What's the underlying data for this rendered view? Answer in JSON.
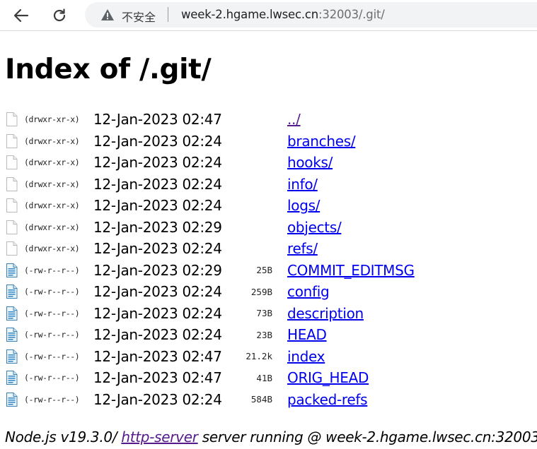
{
  "browser": {
    "security_label": "不安全",
    "url_host": "week-2.hgame.lwsec.cn",
    "url_rest": ":32003/.git/"
  },
  "page": {
    "title": "Index of /.git/",
    "entries": [
      {
        "icon": "folder-icon",
        "perms": "(drwxr-xr-x)",
        "date": "12-Jan-2023 02:47",
        "size": "",
        "name": "../",
        "visited": true
      },
      {
        "icon": "folder-icon",
        "perms": "(drwxr-xr-x)",
        "date": "12-Jan-2023 02:24",
        "size": "",
        "name": "branches/",
        "visited": false
      },
      {
        "icon": "folder-icon",
        "perms": "(drwxr-xr-x)",
        "date": "12-Jan-2023 02:24",
        "size": "",
        "name": "hooks/",
        "visited": false
      },
      {
        "icon": "folder-icon",
        "perms": "(drwxr-xr-x)",
        "date": "12-Jan-2023 02:24",
        "size": "",
        "name": "info/",
        "visited": false
      },
      {
        "icon": "folder-icon",
        "perms": "(drwxr-xr-x)",
        "date": "12-Jan-2023 02:24",
        "size": "",
        "name": "logs/",
        "visited": false
      },
      {
        "icon": "folder-icon",
        "perms": "(drwxr-xr-x)",
        "date": "12-Jan-2023 02:29",
        "size": "",
        "name": "objects/",
        "visited": false
      },
      {
        "icon": "folder-icon",
        "perms": "(drwxr-xr-x)",
        "date": "12-Jan-2023 02:24",
        "size": "",
        "name": "refs/",
        "visited": false
      },
      {
        "icon": "file-icon",
        "perms": "(-rw-r--r--)",
        "date": "12-Jan-2023 02:29",
        "size": "25B",
        "name": "COMMIT_EDITMSG",
        "visited": false
      },
      {
        "icon": "file-icon",
        "perms": "(-rw-r--r--)",
        "date": "12-Jan-2023 02:24",
        "size": "259B",
        "name": "config",
        "visited": false
      },
      {
        "icon": "file-icon",
        "perms": "(-rw-r--r--)",
        "date": "12-Jan-2023 02:24",
        "size": "73B",
        "name": "description",
        "visited": false
      },
      {
        "icon": "file-icon",
        "perms": "(-rw-r--r--)",
        "date": "12-Jan-2023 02:24",
        "size": "23B",
        "name": "HEAD",
        "visited": false
      },
      {
        "icon": "file-icon",
        "perms": "(-rw-r--r--)",
        "date": "12-Jan-2023 02:47",
        "size": "21.2k",
        "name": "index",
        "visited": false
      },
      {
        "icon": "file-icon",
        "perms": "(-rw-r--r--)",
        "date": "12-Jan-2023 02:47",
        "size": "41B",
        "name": "ORIG_HEAD",
        "visited": false
      },
      {
        "icon": "file-icon",
        "perms": "(-rw-r--r--)",
        "date": "12-Jan-2023 02:24",
        "size": "584B",
        "name": "packed-refs",
        "visited": false
      }
    ]
  },
  "footer": {
    "prefix": "Node.js v19.3.0/ ",
    "link_text": "http-server",
    "suffix": " server running @ week-2.hgame.lwsec.cn:32003"
  }
}
